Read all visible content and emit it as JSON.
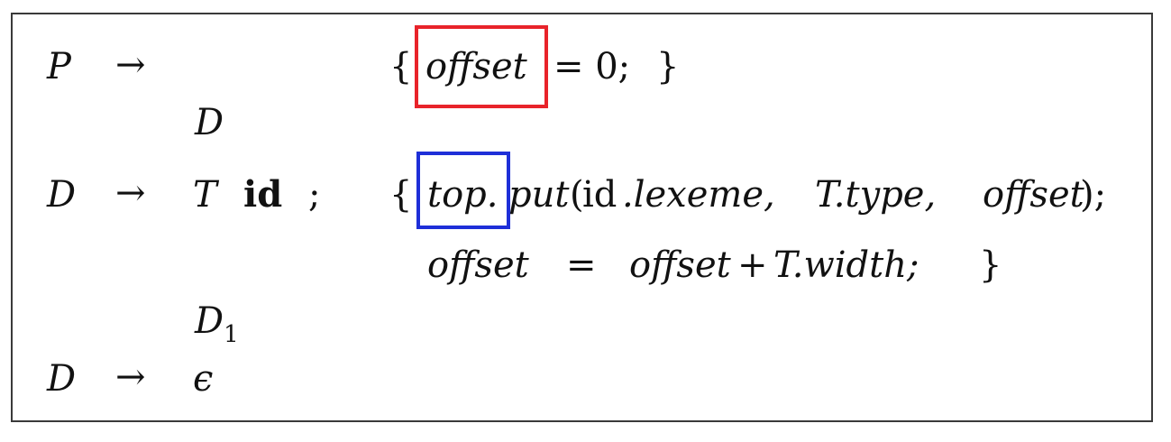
{
  "rules": {
    "r1": {
      "lhs": "P",
      "arrow": "→",
      "action": {
        "open": "{",
        "var": "offset",
        "rest": "= 0;",
        "close": "}"
      }
    },
    "r1_body": {
      "sym": "D"
    },
    "r2": {
      "lhs": "D",
      "arrow": "→",
      "t": "T",
      "id": "id",
      "semi": ";",
      "action1": {
        "open": "{",
        "top": "top.",
        "put": "put",
        "paren": "(",
        "idkw": "id",
        "lexeme": ".lexeme,",
        "ttype": "T.type,",
        "offset": "offset",
        "close": ");"
      },
      "action2": {
        "lhs": "offset",
        "eq": "=",
        "rhs": "offset",
        "plus": "+",
        "twidth": "T.width;",
        "close": "}"
      }
    },
    "r2_body": {
      "sym": "D",
      "sub": "1"
    },
    "r3": {
      "lhs": "D",
      "arrow": "→",
      "eps": "ϵ"
    }
  },
  "highlights": {
    "red": "#e8232a",
    "blue": "#1e2fd8"
  }
}
